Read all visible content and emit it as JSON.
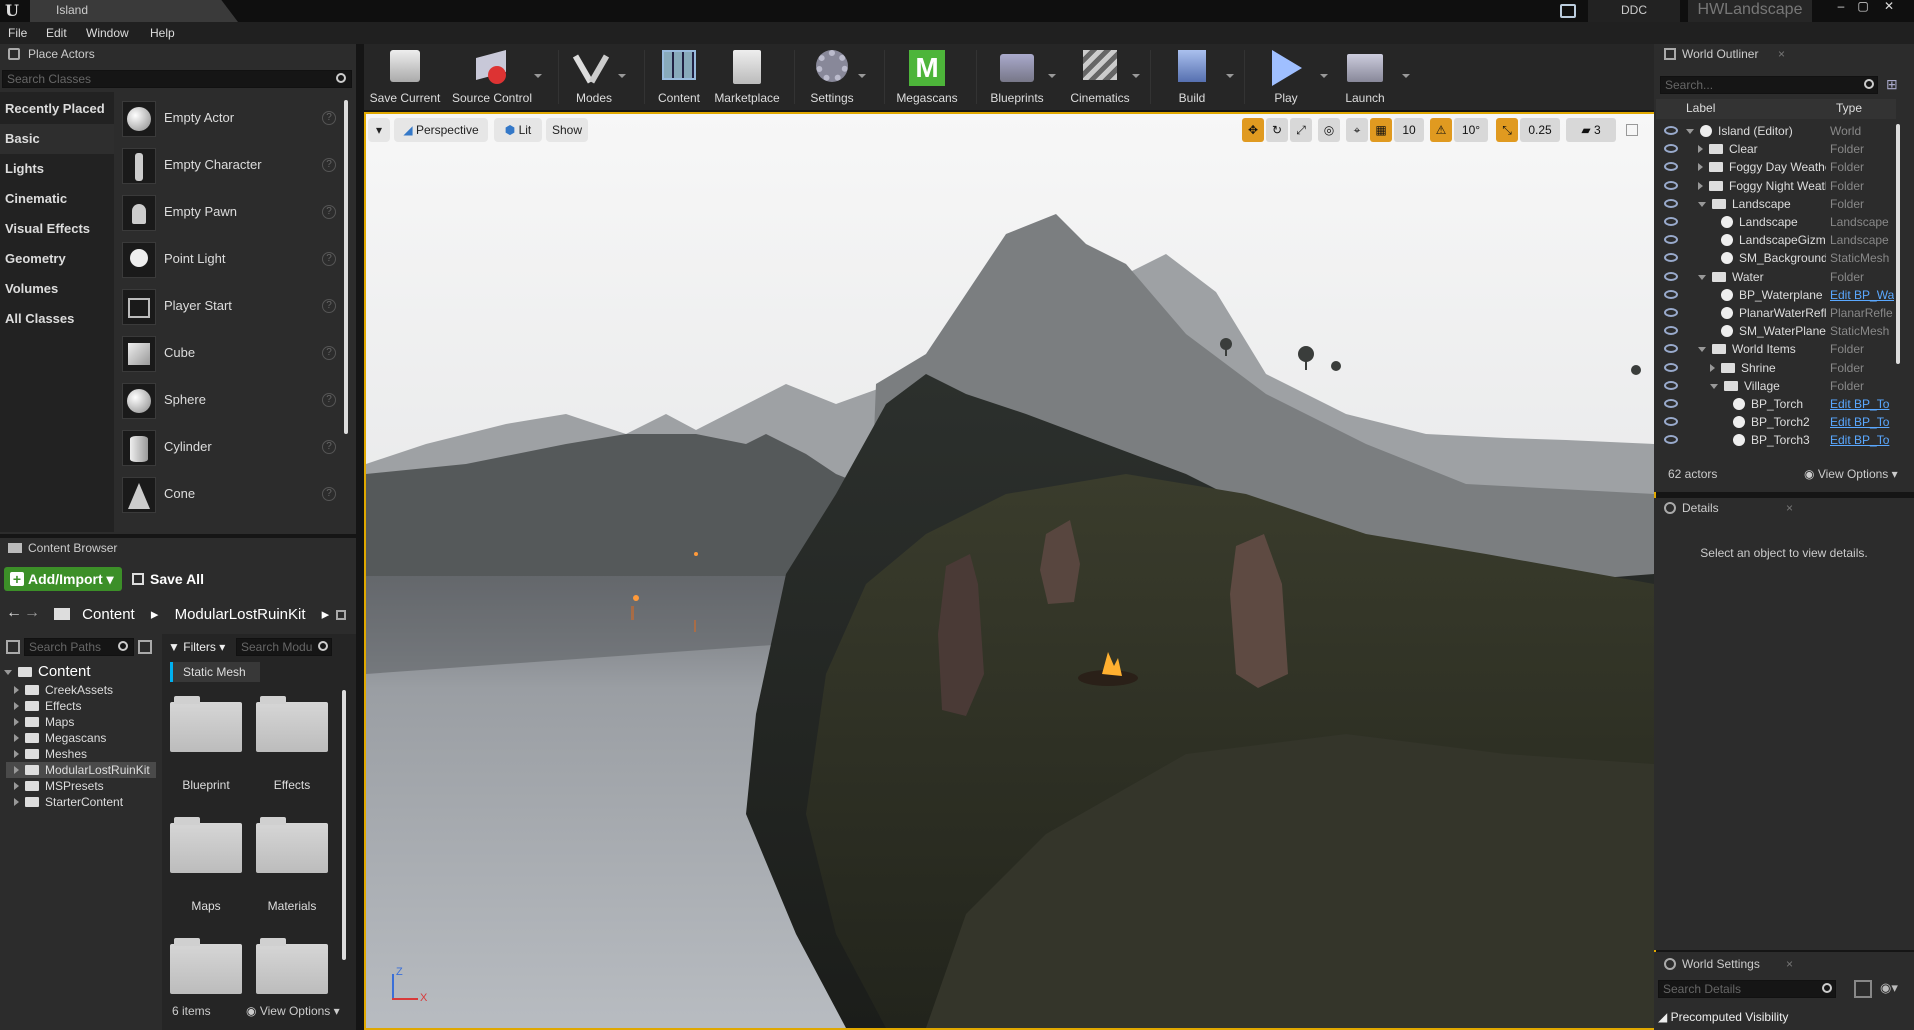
{
  "title_bar": {
    "logo": "U",
    "document_tab": "Island",
    "ddc_label": "DDC",
    "project_name": "HWLandscape"
  },
  "menu": [
    "File",
    "Edit",
    "Window",
    "Help"
  ],
  "place_actors": {
    "tab_label": "Place Actors",
    "search_placeholder": "Search Classes",
    "categories": [
      "Recently Placed",
      "Basic",
      "Lights",
      "Cinematic",
      "Visual Effects",
      "Geometry",
      "Volumes",
      "All Classes"
    ],
    "selected_category": "Basic",
    "actors": [
      "Empty Actor",
      "Empty Character",
      "Empty Pawn",
      "Point Light",
      "Player Start",
      "Cube",
      "Sphere",
      "Cylinder",
      "Cone"
    ],
    "help_glyph": "?"
  },
  "toolbar": {
    "buttons": [
      "Save Current",
      "Source Control",
      "Modes",
      "Content",
      "Marketplace",
      "Settings",
      "Megascans",
      "Blueprints",
      "Cinematics",
      "Build",
      "Play",
      "Launch"
    ]
  },
  "viewport": {
    "perspective_label": "Perspective",
    "lit_label": "Lit",
    "show_label": "Show",
    "grid_snap": "10",
    "rotation_snap": "10°",
    "scale_snap": "0.25",
    "camera_speed": "3",
    "axis_z": "Z",
    "axis_x": "X"
  },
  "world_outliner": {
    "tab_label": "World Outliner",
    "search_placeholder": "Search...",
    "col_label": "Label",
    "col_type": "Type",
    "rows": [
      {
        "label": "Island (Editor)",
        "type": "World",
        "indent": 0,
        "kind": "world",
        "expand": "open"
      },
      {
        "label": "Clear",
        "type": "Folder",
        "indent": 1,
        "kind": "folder",
        "expand": "closed"
      },
      {
        "label": "Foggy Day Weather",
        "type": "Folder",
        "indent": 1,
        "kind": "folder",
        "expand": "closed"
      },
      {
        "label": "Foggy Night Weath",
        "type": "Folder",
        "indent": 1,
        "kind": "folder",
        "expand": "closed"
      },
      {
        "label": "Landscape",
        "type": "Folder",
        "indent": 1,
        "kind": "folder",
        "expand": "open"
      },
      {
        "label": "Landscape",
        "type": "Landscape",
        "indent": 2,
        "kind": "obj",
        "expand": ""
      },
      {
        "label": "LandscapeGizmo",
        "type": "Landscape",
        "indent": 2,
        "kind": "obj",
        "expand": ""
      },
      {
        "label": "SM_Background",
        "type": "StaticMesh",
        "indent": 2,
        "kind": "obj",
        "expand": ""
      },
      {
        "label": "Water",
        "type": "Folder",
        "indent": 1,
        "kind": "folder",
        "expand": "open"
      },
      {
        "label": "BP_Waterplane",
        "type": "Edit BP_Wa",
        "indent": 2,
        "kind": "obj",
        "expand": "",
        "link": true
      },
      {
        "label": "PlanarWaterRefle",
        "type": "PlanarRefle",
        "indent": 2,
        "kind": "obj",
        "expand": ""
      },
      {
        "label": "SM_WaterPlane",
        "type": "StaticMesh",
        "indent": 2,
        "kind": "obj",
        "expand": ""
      },
      {
        "label": "World Items",
        "type": "Folder",
        "indent": 1,
        "kind": "folder",
        "expand": "open"
      },
      {
        "label": "Shrine",
        "type": "Folder",
        "indent": 2,
        "kind": "folder",
        "expand": "closed"
      },
      {
        "label": "Village",
        "type": "Folder",
        "indent": 2,
        "kind": "folder",
        "expand": "open"
      },
      {
        "label": "BP_Torch",
        "type": "Edit BP_To",
        "indent": 3,
        "kind": "obj",
        "expand": "",
        "link": true
      },
      {
        "label": "BP_Torch2",
        "type": "Edit BP_To",
        "indent": 3,
        "kind": "obj",
        "expand": "",
        "link": true
      },
      {
        "label": "BP_Torch3",
        "type": "Edit BP_To",
        "indent": 3,
        "kind": "obj",
        "expand": "",
        "link": true
      }
    ],
    "actor_count": "62 actors",
    "view_options": "View Options"
  },
  "details": {
    "tab_label": "Details",
    "empty_message": "Select an object to view details."
  },
  "world_settings": {
    "tab_label": "World Settings",
    "search_placeholder": "Search Details",
    "section": "Precomputed Visibility"
  },
  "content_browser": {
    "tab_label": "Content Browser",
    "add_import": "Add/Import",
    "save_all": "Save All",
    "breadcrumb": [
      "Content",
      "ModularLostRuinKit"
    ],
    "search_paths_placeholder": "Search Paths",
    "filters_label": "Filters",
    "search_assets_placeholder": "Search Modu",
    "active_filter": "Static Mesh",
    "tree_root": "Content",
    "tree": [
      "CreekAssets",
      "Effects",
      "Maps",
      "Megascans",
      "Meshes",
      "ModularLostRuinKit",
      "MSPresets",
      "StarterContent"
    ],
    "tree_selected": "ModularLostRuinKit",
    "assets": [
      "Blueprint",
      "Effects",
      "Maps",
      "Materials",
      "",
      ""
    ],
    "item_count": "6 items",
    "view_options": "View Options"
  },
  "colors": {
    "accent_yellow": "#e0a800",
    "add_import_green": "#3c8f28",
    "megascans_green": "#4db53a",
    "link_blue": "#5aa8ff"
  }
}
